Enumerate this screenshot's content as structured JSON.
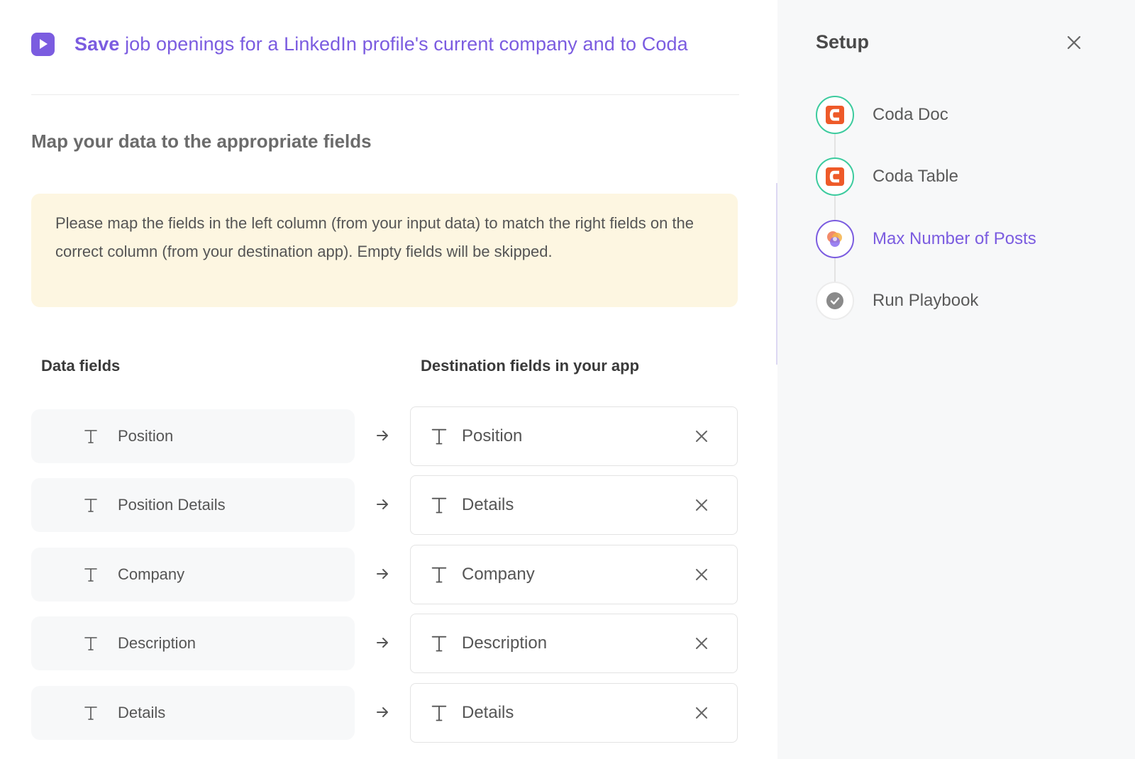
{
  "header": {
    "title_bold": "Save",
    "title_rest": " job openings for a LinkedIn profile's current company and to Coda"
  },
  "section_title": "Map your data to the appropriate fields",
  "notice": "Please map the fields in the left column (from your input data) to match the right fields on the correct column (from your destination app). Empty fields will be skipped.",
  "columns": {
    "data": "Data fields",
    "destination": "Destination fields in your app"
  },
  "mappings": [
    {
      "source": "Position",
      "destination": "Position"
    },
    {
      "source": "Position Details",
      "destination": "Details"
    },
    {
      "source": "Company",
      "destination": "Company"
    },
    {
      "source": "Description",
      "destination": "Description"
    },
    {
      "source": "Details",
      "destination": "Details"
    }
  ],
  "sidebar": {
    "title": "Setup",
    "steps": [
      {
        "label": "Coda Doc",
        "icon": "coda-icon",
        "state": "done"
      },
      {
        "label": "Coda Table",
        "icon": "coda-icon",
        "state": "done"
      },
      {
        "label": "Max Number of Posts",
        "icon": "app-logo-icon",
        "state": "active"
      },
      {
        "label": "Run Playbook",
        "icon": "check-icon",
        "state": "pending"
      }
    ]
  },
  "colors": {
    "accent": "#7b5ce0",
    "done": "#3ccb9e",
    "notice_bg": "#fdf6e1",
    "coda": "#ee5a29"
  }
}
